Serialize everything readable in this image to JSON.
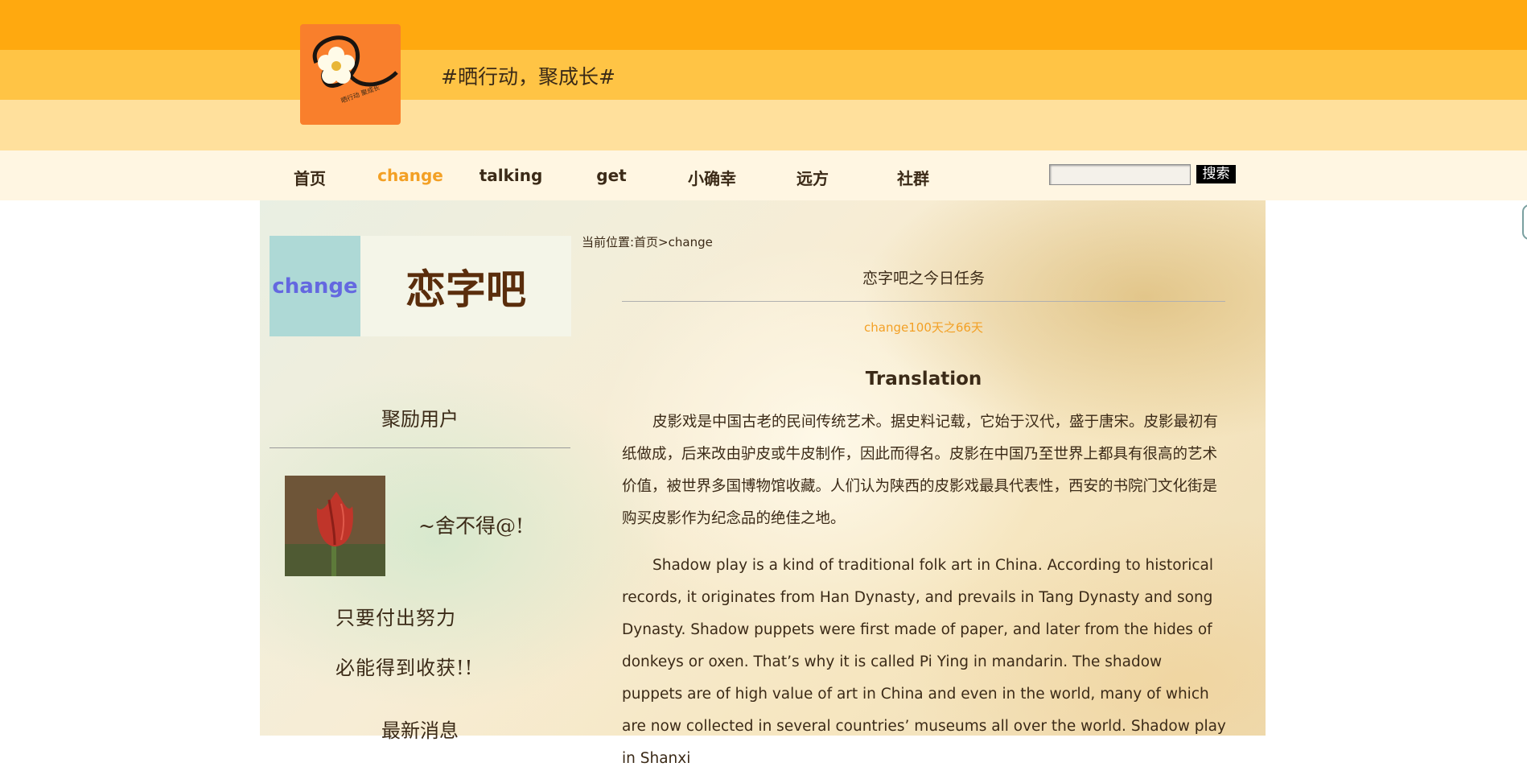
{
  "header": {
    "logo_text": "晒行动 聚成长",
    "slogan": "#晒行动，聚成长#"
  },
  "nav": {
    "items": [
      {
        "label": "首页"
      },
      {
        "label": "change"
      },
      {
        "label": "talking"
      },
      {
        "label": "get"
      },
      {
        "label": "小确幸"
      },
      {
        "label": "远方"
      },
      {
        "label": "社群"
      }
    ],
    "active_index": 1,
    "search_value": "",
    "search_button": "搜索"
  },
  "sidebar": {
    "title_left": "change",
    "title_right": "恋字吧",
    "users_heading": "聚励用户",
    "user_name": "~舍不得@!",
    "motto_line1": "只要付出努力",
    "motto_line2": "必能得到收获!!",
    "news_heading": "最新消息"
  },
  "main": {
    "breadcrumb": "当前位置:首页>change",
    "title": "恋字吧之今日任务",
    "day_count": "change100天之66天",
    "section_title": "Translation",
    "para_cn": "皮影戏是中国古老的民间传统艺术。据史料记载，它始于汉代，盛于唐宋。皮影最初有纸做成，后来改由驴皮或牛皮制作，因此而得名。皮影在中国乃至世界上都具有很高的艺术价值，被世界多国博物馆收藏。人们认为陕西的皮影戏最具代表性，西安的书院门文化街是购买皮影作为纪念品的绝佳之地。",
    "para_en": "Shadow play is a kind of traditional folk art in China. According to historical records, it originates from Han Dynasty, and prevails in Tang Dynasty and song Dynasty. Shadow puppets were first made of paper, and later from the hides of donkeys or oxen. That’s why it is called Pi Ying in mandarin. The shadow puppets are of high value of art in China and even in the world, many of which are now collected in several countries’ museums all over the world. Shadow play in Shanxi"
  },
  "colors": {
    "band_top": "#ffa90f",
    "band_mid": "#ffc445",
    "band_low": "#ffe09c",
    "nav_bg": "#fff6e2",
    "nav_active": "#f3a025",
    "text": "#3b2a17",
    "logo_bg": "#f97f2c"
  }
}
